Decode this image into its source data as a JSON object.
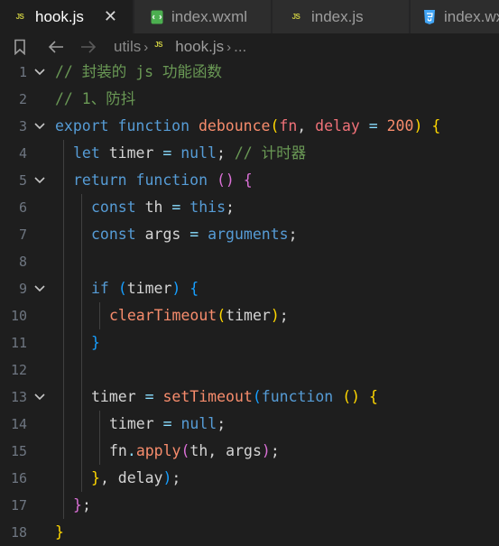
{
  "tabs": [
    {
      "label": "hook.js",
      "icon": "js-file-icon",
      "active": true
    },
    {
      "label": "index.wxml",
      "icon": "wxml-file-icon",
      "active": false
    },
    {
      "label": "index.js",
      "icon": "js-file-icon",
      "active": false
    },
    {
      "label": "index.wxss",
      "icon": "css-file-icon",
      "active": false
    }
  ],
  "tab_icon_text": "JS",
  "close_glyph": "✕",
  "breadcrumb": {
    "folder": "utils",
    "file": "hook.js",
    "more": "..."
  },
  "code": {
    "line_numbers": [
      "1",
      "2",
      "3",
      "4",
      "5",
      "6",
      "7",
      "8",
      "9",
      "10",
      "11",
      "12",
      "13",
      "14",
      "15",
      "16",
      "17",
      "18"
    ],
    "lines": [
      [
        {
          "t": "// 封装的 js 功能函数",
          "c": "t-comment"
        }
      ],
      [
        {
          "t": "// 1、防抖",
          "c": "t-comment"
        }
      ],
      [
        {
          "t": "export",
          "c": "t-kw"
        },
        {
          "t": " "
        },
        {
          "t": "function",
          "c": "t-kw"
        },
        {
          "t": " "
        },
        {
          "t": "debounce",
          "c": "t-fn"
        },
        {
          "t": "(",
          "c": "t-p1"
        },
        {
          "t": "fn",
          "c": "t-param"
        },
        {
          "t": ", "
        },
        {
          "t": "delay",
          "c": "t-param"
        },
        {
          "t": " "
        },
        {
          "t": "=",
          "c": "t-op"
        },
        {
          "t": " "
        },
        {
          "t": "200",
          "c": "t-num"
        },
        {
          "t": ")",
          "c": "t-p1"
        },
        {
          "t": " "
        },
        {
          "t": "{",
          "c": "t-p1"
        }
      ],
      [
        {
          "t": "let",
          "c": "t-kw"
        },
        {
          "t": " timer "
        },
        {
          "t": "=",
          "c": "t-op"
        },
        {
          "t": " "
        },
        {
          "t": "null",
          "c": "t-kw"
        },
        {
          "t": "; "
        },
        {
          "t": "// 计时器",
          "c": "t-comment"
        }
      ],
      [
        {
          "t": "return",
          "c": "t-kw"
        },
        {
          "t": " "
        },
        {
          "t": "function",
          "c": "t-kw"
        },
        {
          "t": " "
        },
        {
          "t": "()",
          "c": "t-p2"
        },
        {
          "t": " "
        },
        {
          "t": "{",
          "c": "t-p2"
        }
      ],
      [
        {
          "t": "const",
          "c": "t-kw"
        },
        {
          "t": " th "
        },
        {
          "t": "=",
          "c": "t-op"
        },
        {
          "t": " "
        },
        {
          "t": "this",
          "c": "t-this"
        },
        {
          "t": ";"
        }
      ],
      [
        {
          "t": "const",
          "c": "t-kw"
        },
        {
          "t": " args "
        },
        {
          "t": "=",
          "c": "t-op"
        },
        {
          "t": " "
        },
        {
          "t": "arguments",
          "c": "t-args"
        },
        {
          "t": ";"
        }
      ],
      [],
      [
        {
          "t": "if",
          "c": "t-kw"
        },
        {
          "t": " "
        },
        {
          "t": "(",
          "c": "t-p3"
        },
        {
          "t": "timer"
        },
        {
          "t": ")",
          "c": "t-p3"
        },
        {
          "t": " "
        },
        {
          "t": "{",
          "c": "t-p3"
        }
      ],
      [
        {
          "t": "clearTimeout",
          "c": "t-call"
        },
        {
          "t": "(",
          "c": "t-p1"
        },
        {
          "t": "timer"
        },
        {
          "t": ")",
          "c": "t-p1"
        },
        {
          "t": ";"
        }
      ],
      [
        {
          "t": "}",
          "c": "t-p3"
        }
      ],
      [],
      [
        {
          "t": "timer "
        },
        {
          "t": "=",
          "c": "t-op"
        },
        {
          "t": " "
        },
        {
          "t": "setTimeout",
          "c": "t-call"
        },
        {
          "t": "(",
          "c": "t-p3"
        },
        {
          "t": "function",
          "c": "t-kw"
        },
        {
          "t": " "
        },
        {
          "t": "()",
          "c": "t-p1"
        },
        {
          "t": " "
        },
        {
          "t": "{",
          "c": "t-p1"
        }
      ],
      [
        {
          "t": "timer "
        },
        {
          "t": "=",
          "c": "t-op"
        },
        {
          "t": " "
        },
        {
          "t": "null",
          "c": "t-kw"
        },
        {
          "t": ";"
        }
      ],
      [
        {
          "t": "fn"
        },
        {
          "t": ".",
          "c": "t-op"
        },
        {
          "t": "apply",
          "c": "t-call"
        },
        {
          "t": "(",
          "c": "t-p2"
        },
        {
          "t": "th, args"
        },
        {
          "t": ")",
          "c": "t-p2"
        },
        {
          "t": ";"
        }
      ],
      [
        {
          "t": "}",
          "c": "t-p1"
        },
        {
          "t": ", delay"
        },
        {
          "t": ")",
          "c": "t-p3"
        },
        {
          "t": ";"
        }
      ],
      [
        {
          "t": "}",
          "c": "t-p2"
        },
        {
          "t": ";"
        }
      ],
      [
        {
          "t": "}",
          "c": "t-p1"
        }
      ]
    ]
  },
  "colors": {
    "editor_bg": "#1e1e1e",
    "tabbar_bg": "#252526",
    "keyword": "#569cd6",
    "comment": "#6a9955",
    "function": "#f78c6c"
  }
}
